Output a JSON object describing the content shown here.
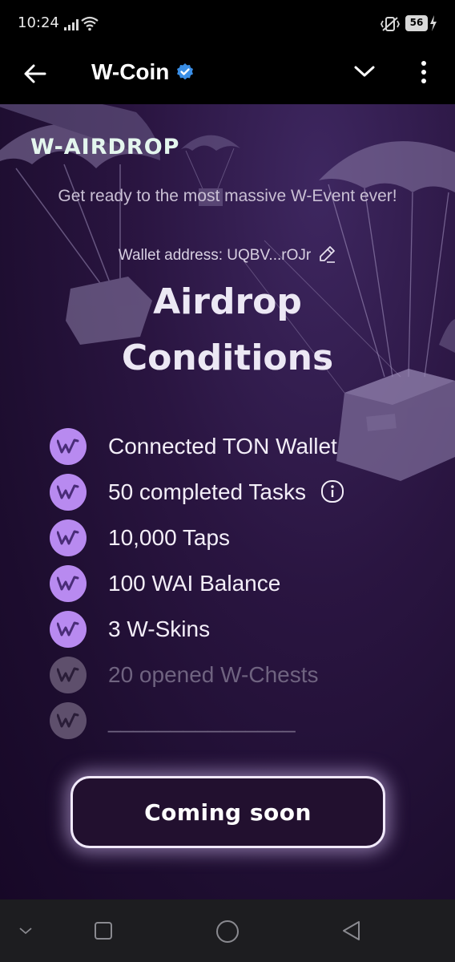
{
  "status_bar": {
    "time": "10:24",
    "battery_level": "56"
  },
  "header": {
    "title": "W-Coin",
    "icons": [
      "back-arrow-icon",
      "verified-icon",
      "chevron-down-icon",
      "more-vertical-icon"
    ]
  },
  "airdrop": {
    "brand": "W-AIRDROP",
    "subtitle": "Get ready to the most massive W-Event ever!",
    "wallet_label": "Wallet address: UQBV...rOJr",
    "title_line1": "Airdrop",
    "title_line2": "Conditions",
    "conditions": [
      {
        "label": "Connected TON Wallet",
        "done": true
      },
      {
        "label": "50 completed Tasks",
        "done": true,
        "has_info": true
      },
      {
        "label": "10,000 Taps",
        "done": true
      },
      {
        "label": "100 WAI Balance",
        "done": true
      },
      {
        "label": "3 W-Skins",
        "done": true
      },
      {
        "label": "20 opened W-Chests",
        "done": false
      },
      {
        "label": "_______________",
        "done": false
      }
    ],
    "button_label": "Coming soon"
  },
  "colors": {
    "accent_badge": "#b88af0",
    "dim_badge": "#5e4f6c",
    "background": "#1d0d2f"
  },
  "nav_bar": {
    "icons": [
      "hide-keyboard-icon",
      "recents-icon",
      "home-icon",
      "back-triangle-icon"
    ]
  }
}
